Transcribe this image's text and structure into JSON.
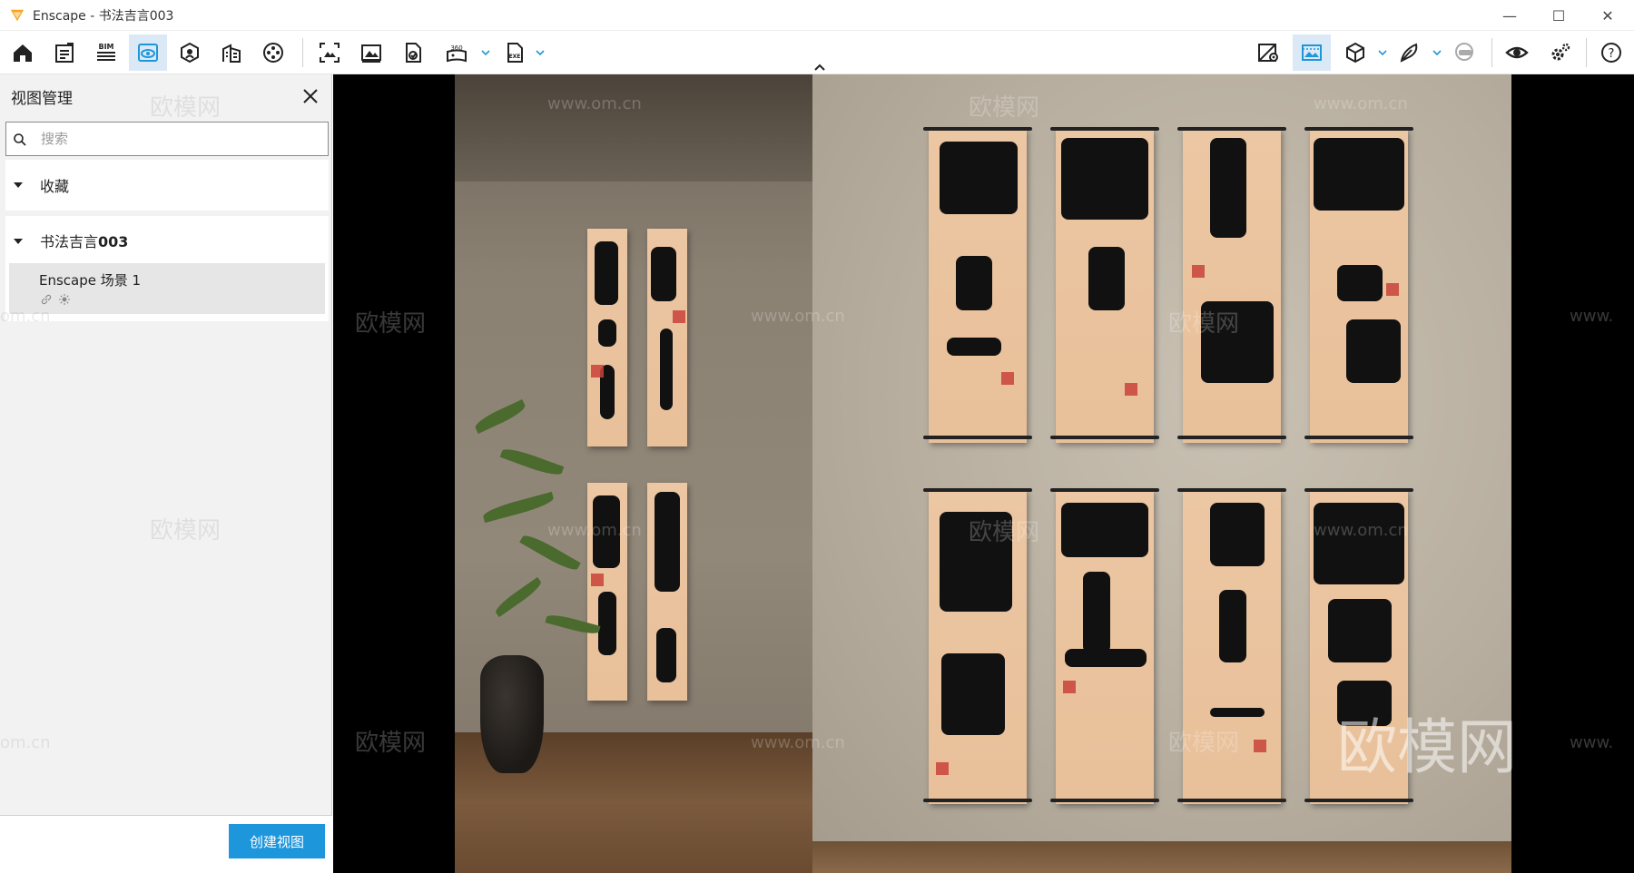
{
  "window": {
    "app_title": "Enscape - 书法吉言003",
    "controls": {
      "minimize": "—",
      "maximize": "☐",
      "close": "✕"
    }
  },
  "toolbar": {
    "buttons": [
      {
        "name": "home-icon"
      },
      {
        "name": "notes-icon"
      },
      {
        "name": "bim-icon",
        "text": "BIM"
      },
      {
        "name": "view-management-icon",
        "active": true
      },
      {
        "name": "asset-library-icon"
      },
      {
        "name": "building-icon"
      },
      {
        "name": "video-editor-icon"
      },
      {
        "name": "screenshot-icon"
      },
      {
        "name": "batch-render-icon"
      },
      {
        "name": "export-web-icon"
      },
      {
        "name": "panorama-360-icon",
        "text": "360"
      },
      {
        "name": "exe-export-icon",
        "text": "EXE"
      },
      {
        "name": "map-pin-icon"
      },
      {
        "name": "image-settings-icon",
        "active": true
      },
      {
        "name": "cube-icon"
      },
      {
        "name": "feather-icon"
      },
      {
        "name": "vr-headset-icon"
      },
      {
        "name": "eye-icon"
      },
      {
        "name": "settings-icon"
      },
      {
        "name": "help-icon",
        "text": "?"
      }
    ],
    "accent_color": "#1e96dc"
  },
  "panel": {
    "title": "视图管理",
    "search_placeholder": "搜索",
    "sections": [
      {
        "label": "收藏"
      },
      {
        "label": "书法吉言",
        "label_bold_suffix": "003"
      }
    ],
    "views": [
      {
        "name": "Enscape 场景 1"
      }
    ],
    "create_button": "创建视图"
  },
  "watermarks": {
    "site": "www.om.cn",
    "site_cut": "om.cn",
    "site_cut_right": "www.",
    "brand": "欧模网"
  }
}
